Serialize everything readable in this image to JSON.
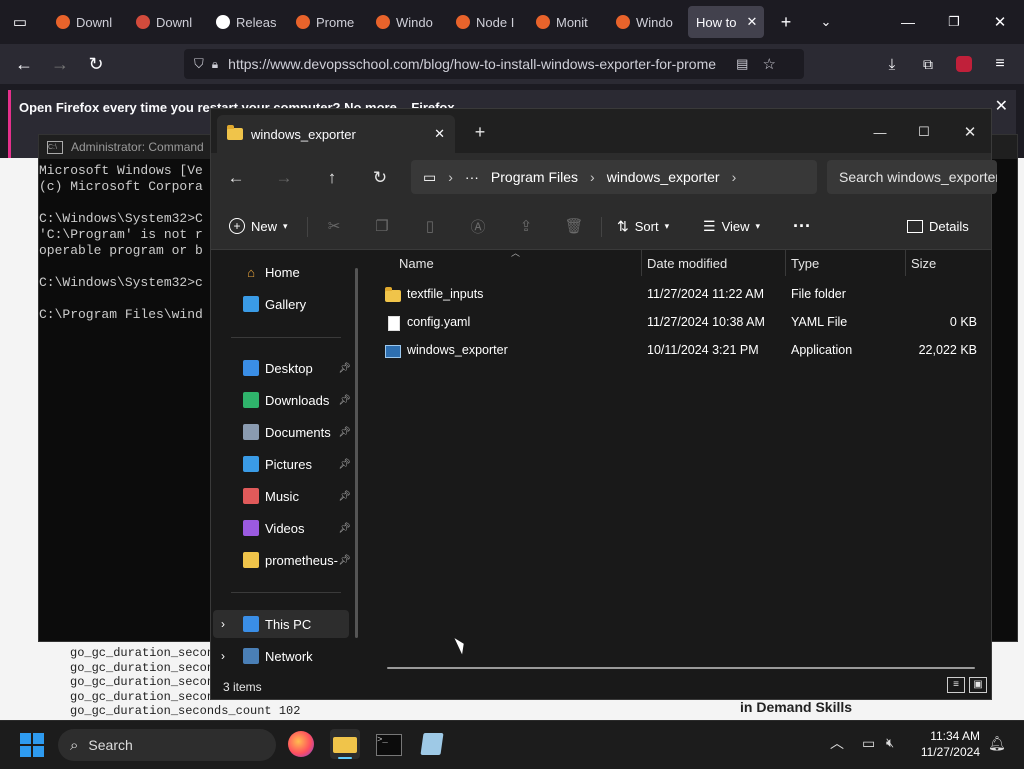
{
  "browser": {
    "tabs": [
      {
        "label": "Downl",
        "fav": "grafana-icon"
      },
      {
        "label": "Downl",
        "fav": "red-icon"
      },
      {
        "label": "Releas",
        "fav": "github-icon"
      },
      {
        "label": "Prome",
        "fav": "prometheus-icon"
      },
      {
        "label": "Windo",
        "fav": "grafana-icon"
      },
      {
        "label": "Node I",
        "fav": "grafana-icon"
      },
      {
        "label": "Monit",
        "fav": "grafana-icon"
      },
      {
        "label": "Windo",
        "fav": "grafana-icon"
      }
    ],
    "active_tab": "How to",
    "url": "https://www.devopsschool.com/blog/how-to-install-windows-exporter-for-prome",
    "notification": "Open Firefox every time you restart your computer? No more... Firefox..."
  },
  "webpage": {
    "lines": [
      "go_gc_duration_second",
      "go_gc_duration_second",
      "go_gc_duration_second",
      "go_gc_duration_second",
      "go_gc_duration_seconds_count 102"
    ],
    "skills": "in Demand Skills"
  },
  "cmd": {
    "title": "Administrator: Command",
    "lines": [
      "Microsoft Windows [Ve",
      "(c) Microsoft Corpora",
      "",
      "C:\\Windows\\System32>C",
      "'C:\\Program' is not r",
      "operable program or b",
      "",
      "C:\\Windows\\System32>c",
      "",
      "C:\\Program Files\\wind"
    ]
  },
  "explorer": {
    "tab_title": "windows_exporter",
    "breadcrumb": [
      "Program Files",
      "windows_exporter"
    ],
    "search_placeholder": "Search windows_exporter",
    "commands": {
      "new": "New",
      "sort": "Sort",
      "view": "View",
      "details": "Details"
    },
    "nav": {
      "home": "Home",
      "gallery": "Gallery",
      "pinned": [
        {
          "label": "Desktop",
          "icon": "desktop-icon",
          "color": "#3a8ee6"
        },
        {
          "label": "Downloads",
          "icon": "download-icon",
          "color": "#2fb36b"
        },
        {
          "label": "Documents",
          "icon": "document-icon",
          "color": "#8a9bb0"
        },
        {
          "label": "Pictures",
          "icon": "pictures-icon",
          "color": "#3a9be6"
        },
        {
          "label": "Music",
          "icon": "music-icon",
          "color": "#e05a5a"
        },
        {
          "label": "Videos",
          "icon": "videos-icon",
          "color": "#9b5ae0"
        },
        {
          "label": "prometheus-",
          "icon": "folder-icon",
          "color": "#f0c44a"
        }
      ],
      "this_pc": "This PC",
      "network": "Network"
    },
    "columns": {
      "name": "Name",
      "date": "Date modified",
      "type": "Type",
      "size": "Size"
    },
    "files": [
      {
        "name": "textfile_inputs",
        "date": "11/27/2024 11:22 AM",
        "type": "File folder",
        "size": "",
        "icon": "folder-icon"
      },
      {
        "name": "config.yaml",
        "date": "11/27/2024 10:38 AM",
        "type": "YAML File",
        "size": "0 KB",
        "icon": "file-icon"
      },
      {
        "name": "windows_exporter",
        "date": "10/11/2024 3:21 PM",
        "type": "Application",
        "size": "22,022 KB",
        "icon": "app-icon"
      }
    ],
    "status": "3 items"
  },
  "taskbar": {
    "search": "Search",
    "time": "11:34 AM",
    "date": "11/27/2024"
  }
}
